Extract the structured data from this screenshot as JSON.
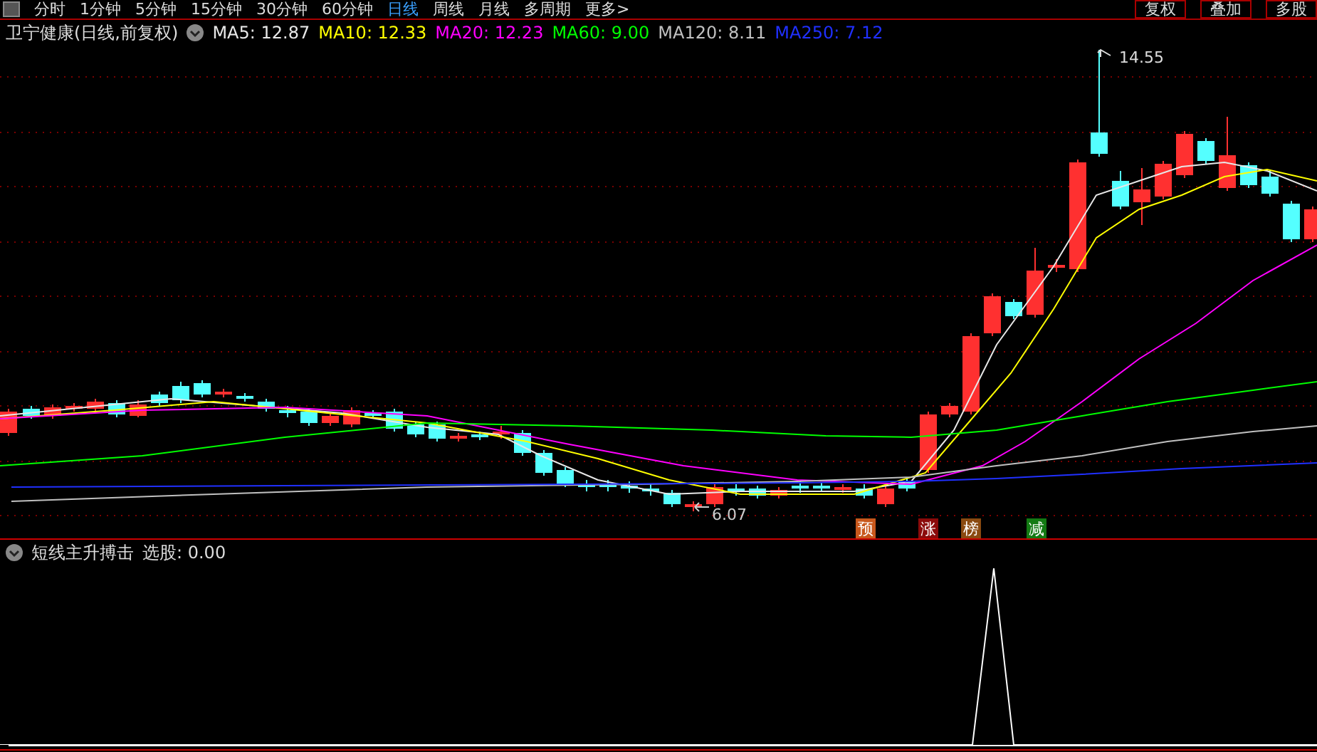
{
  "toolbar": {
    "tabs": [
      {
        "label": "分时",
        "selected": false
      },
      {
        "label": "1分钟",
        "selected": false
      },
      {
        "label": "5分钟",
        "selected": false
      },
      {
        "label": "15分钟",
        "selected": false
      },
      {
        "label": "30分钟",
        "selected": false
      },
      {
        "label": "60分钟",
        "selected": false
      },
      {
        "label": "日线",
        "selected": true
      },
      {
        "label": "周线",
        "selected": false
      },
      {
        "label": "月线",
        "selected": false
      },
      {
        "label": "多周期",
        "selected": false
      },
      {
        "label": "更多>",
        "selected": false
      }
    ],
    "buttons": [
      "复权",
      "叠加",
      "多股"
    ]
  },
  "chart": {
    "stock": "卫宁健康(日线,前复权)",
    "ma": [
      {
        "label": "MA5: 12.87",
        "color": "#e8e8e8"
      },
      {
        "label": "MA10: 12.33",
        "color": "#ffff00"
      },
      {
        "label": "MA20: 12.23",
        "color": "#ff00ff"
      },
      {
        "label": "MA60: 9.00",
        "color": "#00ff00"
      },
      {
        "label": "MA120: 8.11",
        "color": "#c0c0c0"
      },
      {
        "label": "MA250: 7.12",
        "color": "#2030ff"
      }
    ],
    "high_label": "14.55",
    "low_label": "6.07",
    "tags": [
      {
        "text": "预",
        "color": "#c8581c"
      },
      {
        "text": "涨",
        "color": "#8b0a0a"
      },
      {
        "text": "榜",
        "color": "#8a4a10"
      },
      {
        "text": "减",
        "color": "#137a13"
      }
    ]
  },
  "indicator": {
    "name": "短线主升搏击",
    "reading": "选股: 0.00"
  }
}
